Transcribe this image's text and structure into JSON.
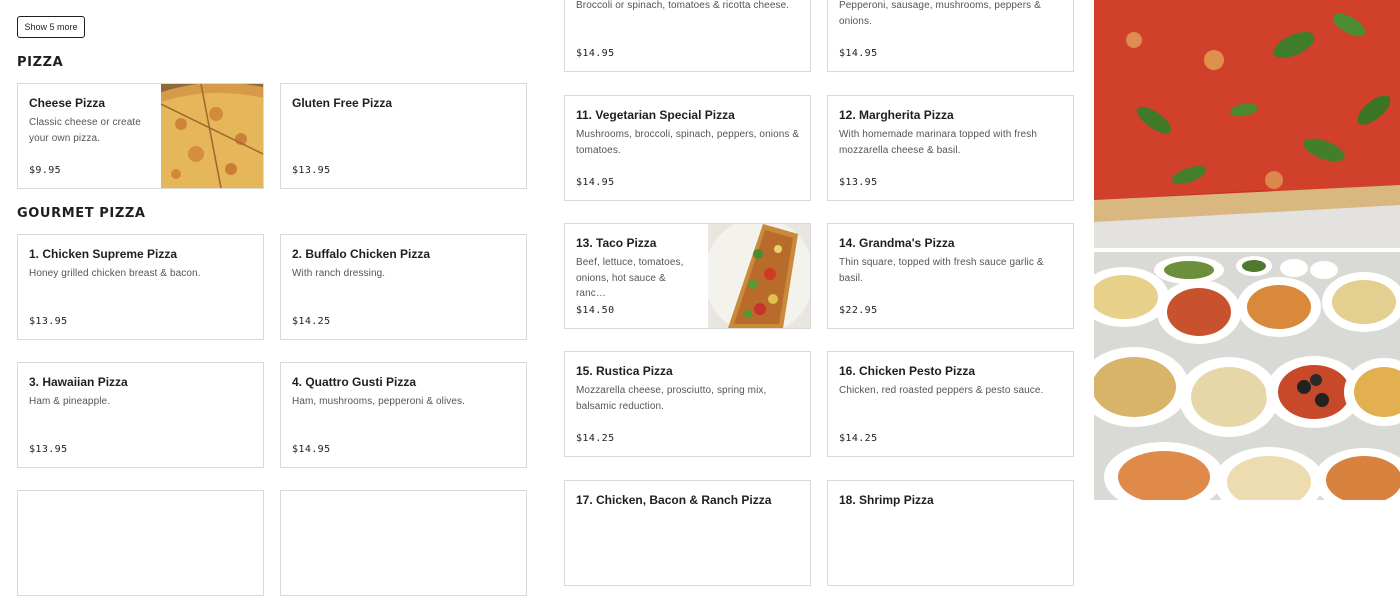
{
  "show_more_label": "Show 5 more",
  "sections": {
    "pizza": "PIZZA",
    "gourmet": "GOURMET PIZZA"
  },
  "left_cards": [
    {
      "name": "Cheese Pizza",
      "desc": "Classic cheese or create your own pizza.",
      "price": "$9.95"
    },
    {
      "name": "Gluten Free Pizza",
      "desc": "",
      "price": "$13.95"
    },
    {
      "name": "1. Chicken Supreme Pizza",
      "desc": "Honey grilled chicken breast & bacon.",
      "price": "$13.95"
    },
    {
      "name": "2. Buffalo Chicken Pizza",
      "desc": "With ranch dressing.",
      "price": "$14.25"
    },
    {
      "name": "3. Hawaiian Pizza",
      "desc": "Ham & pineapple.",
      "price": "$13.95"
    },
    {
      "name": "4. Quattro Gusti Pizza",
      "desc": "Ham, mushrooms, pepperoni & olives.",
      "price": "$14.95"
    }
  ],
  "right_cards": [
    {
      "name": "",
      "desc": "Broccoli or spinach, tomatoes & ricotta cheese.",
      "price": "$14.95"
    },
    {
      "name": "",
      "desc": "Pepperoni, sausage, mushrooms, peppers & onions.",
      "price": "$14.95"
    },
    {
      "name": "11. Vegetarian Special Pizza",
      "desc": "Mushrooms, broccoli, spinach, peppers, onions & tomatoes.",
      "price": "$14.95"
    },
    {
      "name": "12. Margherita Pizza",
      "desc": "With homemade marinara topped with fresh mozzarella cheese & basil.",
      "price": "$13.95"
    },
    {
      "name": "13. Taco Pizza",
      "desc": "Beef, lettuce, tomatoes, onions, hot sauce & ranc…",
      "price": "$14.50"
    },
    {
      "name": "14. Grandma's Pizza",
      "desc": "Thin square, topped with fresh sauce garlic & basil.",
      "price": "$22.95"
    },
    {
      "name": "15. Rustica Pizza",
      "desc": "Mozzarella cheese, prosciutto, spring mix, balsamic reduction.",
      "price": "$14.25"
    },
    {
      "name": "16. Chicken Pesto Pizza",
      "desc": "Chicken, red roasted peppers & pesto sauce.",
      "price": "$14.25"
    },
    {
      "name": "17. Chicken, Bacon & Ranch Pizza",
      "desc": "",
      "price": ""
    },
    {
      "name": "18. Shrimp Pizza",
      "desc": "",
      "price": ""
    }
  ],
  "colors": {
    "text": "#1f1f1f",
    "muted": "#555555",
    "border": "#d9d9d9",
    "sauce": "#c0321c",
    "basil": "#3f7d2a",
    "cheese": "#e9c25a"
  },
  "icons": [
    "cheese-pizza-photo",
    "taco-pizza-photo",
    "margherita-slice-photo",
    "catering-platter-photo"
  ]
}
